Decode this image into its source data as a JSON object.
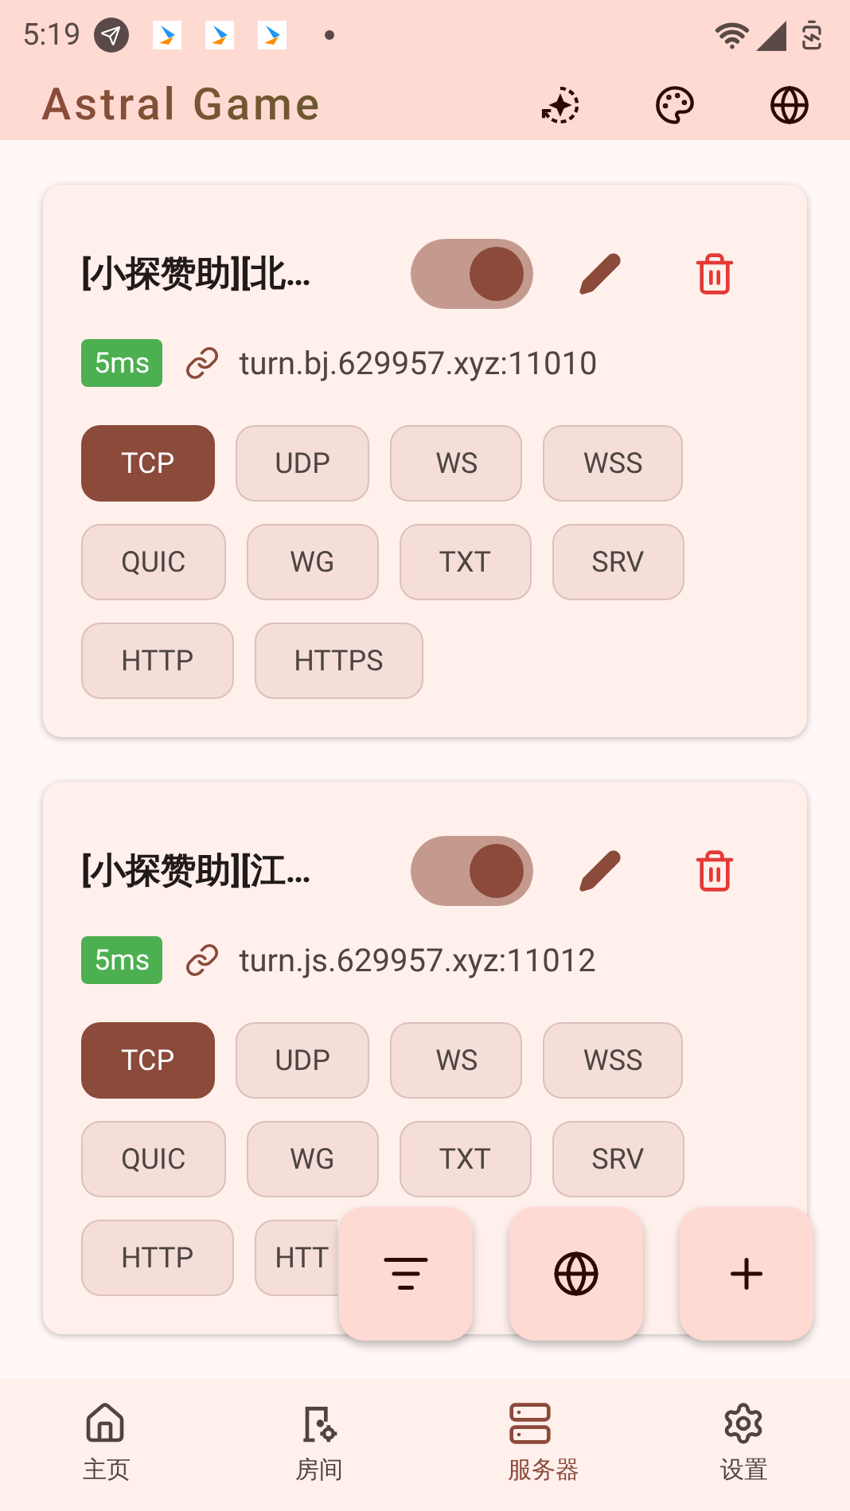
{
  "status_bar": {
    "time": "5:19"
  },
  "app_bar": {
    "title": "Astral Game"
  },
  "servers": [
    {
      "name": "[小探赞助][北…",
      "enabled": true,
      "latency": "5ms",
      "address": "turn.bj.629957.xyz:11010",
      "protocols": [
        {
          "label": "TCP",
          "selected": true
        },
        {
          "label": "UDP",
          "selected": false
        },
        {
          "label": "WS",
          "selected": false
        },
        {
          "label": "WSS",
          "selected": false
        },
        {
          "label": "QUIC",
          "selected": false
        },
        {
          "label": "WG",
          "selected": false
        },
        {
          "label": "TXT",
          "selected": false
        },
        {
          "label": "SRV",
          "selected": false
        },
        {
          "label": "HTTP",
          "selected": false
        },
        {
          "label": "HTTPS",
          "selected": false
        }
      ]
    },
    {
      "name": "[小探赞助][江…",
      "enabled": true,
      "latency": "5ms",
      "address": "turn.js.629957.xyz:11012",
      "protocols": [
        {
          "label": "TCP",
          "selected": true
        },
        {
          "label": "UDP",
          "selected": false
        },
        {
          "label": "WS",
          "selected": false
        },
        {
          "label": "WSS",
          "selected": false
        },
        {
          "label": "QUIC",
          "selected": false
        },
        {
          "label": "WG",
          "selected": false
        },
        {
          "label": "TXT",
          "selected": false
        },
        {
          "label": "SRV",
          "selected": false
        },
        {
          "label": "HTTP",
          "selected": false
        },
        {
          "label": "HTT",
          "selected": false,
          "cut_off": true
        }
      ]
    }
  ],
  "nav": [
    {
      "kind": "home",
      "label": "主页",
      "selected": false
    },
    {
      "kind": "room",
      "label": "房间",
      "selected": false
    },
    {
      "kind": "server",
      "label": "服务器",
      "selected": true
    },
    {
      "kind": "settings",
      "label": "设置",
      "selected": false
    }
  ]
}
